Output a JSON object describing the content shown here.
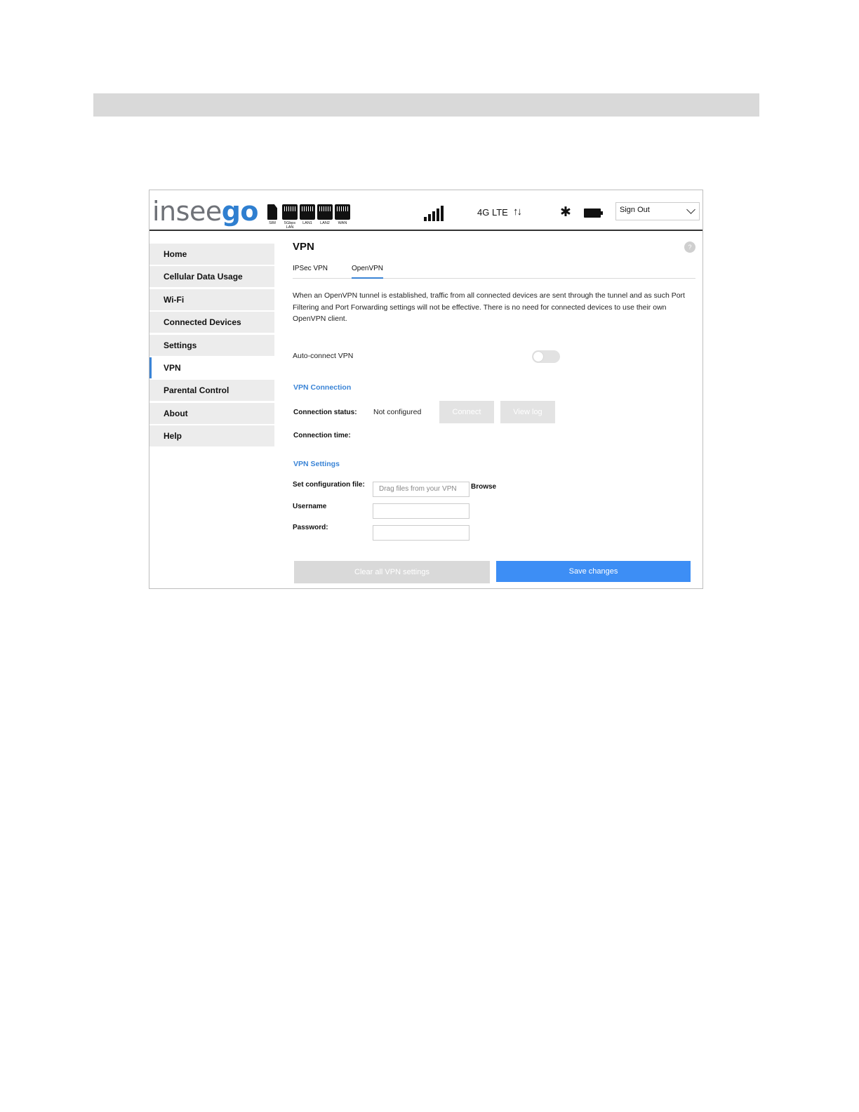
{
  "header": {
    "logo_a": "insee",
    "logo_b": "go",
    "ports": [
      "SIM",
      "5Gbps LAN",
      "LAN1",
      "LAN2",
      "WAN"
    ],
    "network_type": "4G LTE",
    "account_menu": "Sign Out"
  },
  "sidebar": {
    "items": [
      {
        "label": "Home"
      },
      {
        "label": "Cellular Data Usage"
      },
      {
        "label": "Wi-Fi"
      },
      {
        "label": "Connected Devices"
      },
      {
        "label": "Settings"
      },
      {
        "label": "VPN",
        "active": true
      },
      {
        "label": "Parental Control"
      },
      {
        "label": "About"
      },
      {
        "label": "Help"
      }
    ]
  },
  "main": {
    "title": "VPN",
    "help": "?",
    "tabs": [
      {
        "label": "IPSec VPN"
      },
      {
        "label": "OpenVPN",
        "active": true
      }
    ],
    "description": "When an OpenVPN tunnel is established, traffic from all connected devices are sent through the tunnel and as such Port Filtering and Port Forwarding settings will not be effective. There is no need for connected devices to use their own OpenVPN client.",
    "auto_connect_label": "Auto-connect VPN",
    "auto_connect_on": false,
    "connection": {
      "heading": "VPN Connection",
      "status_label": "Connection status:",
      "status_value": "Not configured",
      "connect_button": "Connect",
      "view_log_button": "View log",
      "time_label": "Connection time:"
    },
    "settings": {
      "heading": "VPN Settings",
      "config_label": "Set configuration file:",
      "config_placeholder": "Drag files from your VPN",
      "browse_button": "Browse",
      "username_label": "Username",
      "password_label": "Password:"
    },
    "clear_button": "Clear all VPN settings",
    "save_button": "Save changes"
  },
  "colors": {
    "accent": "#3a84d6",
    "save_button": "#3d8ef5",
    "logo_grey": "#6f7278"
  }
}
